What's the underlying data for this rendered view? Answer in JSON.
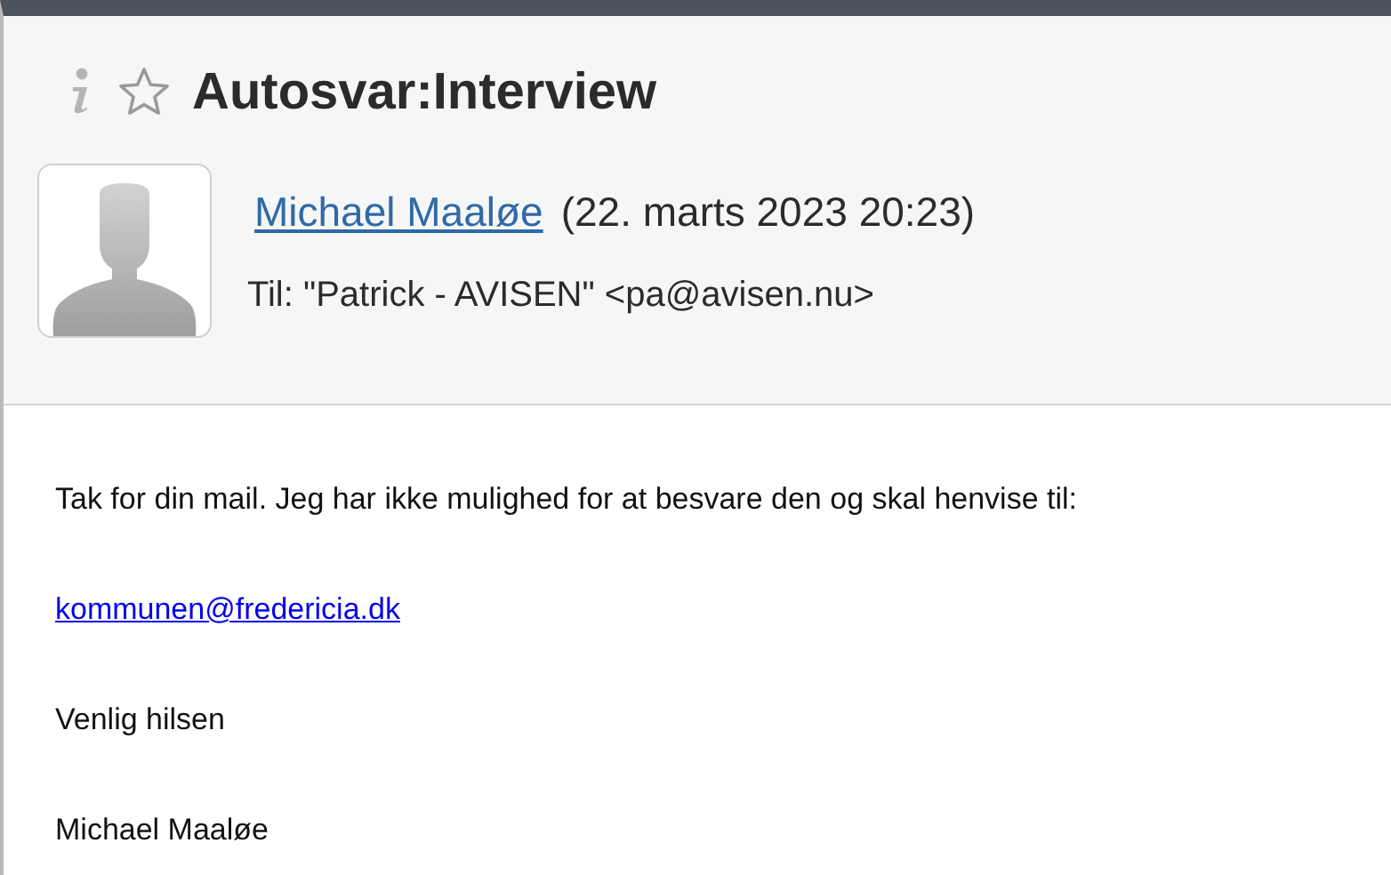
{
  "message": {
    "starred": false,
    "subject": "Autosvar:Interview",
    "sender": {
      "name": "Michael Maaløe",
      "date": "(22. marts 2023 20:23)"
    },
    "to": "Til: \"Patrick - AVISEN\" <pa@avisen.nu>"
  },
  "body": [
    {
      "kind": "text",
      "text": "Tak for din mail. Jeg har ikke mulighed for at besvare den og skal henvise til:"
    },
    {
      "kind": "link",
      "text": "kommunen@fredericia.dk"
    },
    {
      "kind": "text",
      "text": "Venlig hilsen"
    },
    {
      "kind": "text",
      "text": "Michael Maaløe"
    }
  ]
}
